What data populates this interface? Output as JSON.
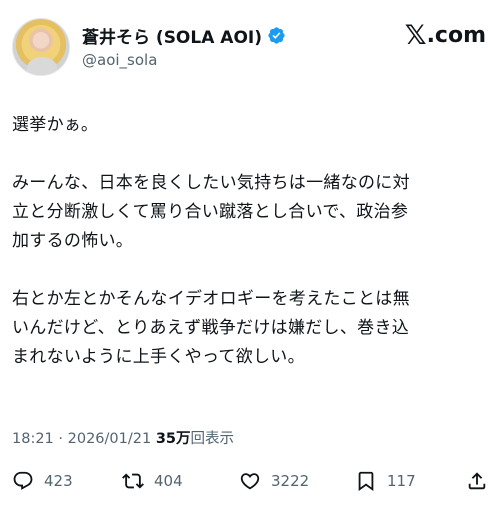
{
  "author": {
    "display_name": "蒼井そら (SOLA AOI)",
    "handle": "@aoi_sola",
    "verified": true,
    "verified_color": "#1d9bf0"
  },
  "brand": {
    "logo_glyph": "𝕏",
    "logo_suffix": ".com"
  },
  "post": {
    "paragraphs": [
      [
        "選挙かぁ。"
      ],
      [
        "みーんな、日本を良くしたい気持ちは一緒なのに対",
        "立と分断激しくて罵り合い蹴落とし合いで、政治参",
        "加するの怖い。"
      ],
      [
        "右とか左とかそんなイデオロギーを考えたことは無",
        "いんだけど、とりあえず戦争だけは嫌だし、巻き込",
        "まれないように上手くやって欲しい。"
      ]
    ]
  },
  "meta": {
    "time": "18:21",
    "separator": "·",
    "date": "2026/01/21",
    "views_count": "35万",
    "views_label": "回表示"
  },
  "actions": {
    "replies": "423",
    "reposts": "404",
    "likes": "3222",
    "bookmarks": "117"
  },
  "icons": [
    "reply-icon",
    "repost-icon",
    "like-icon",
    "bookmark-icon",
    "share-icon",
    "verified-badge-icon"
  ],
  "colors": {
    "text": "#0f1419",
    "secondary": "#536471",
    "verified": "#1d9bf0"
  }
}
